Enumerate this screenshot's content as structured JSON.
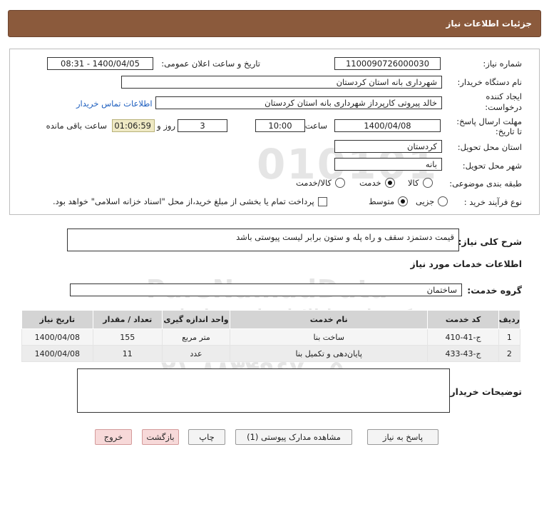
{
  "header": {
    "title": "جزئیات اطلاعات نیاز"
  },
  "form": {
    "need_number_label": "شماره نیاز:",
    "need_number": "1100090726000030",
    "announce_label": "تاریخ و ساعت اعلان عمومی:",
    "announce_value": "1400/04/05 - 08:31",
    "buyer_org_label": "نام دستگاه خریدار:",
    "buyer_org": "شهرداری بانه استان کردستان",
    "creator_label_1": "ایجاد کننده",
    "creator_label_2": "درخواست:",
    "creator": "خالد پیروتی کارپرداز شهرداری بانه استان کردستان",
    "contact_link": "اطلاعات تماس خریدار",
    "deadline_label_1": "مهلت ارسال پاسخ:",
    "deadline_label_2": "تا تاریخ:",
    "deadline_date": "1400/04/08",
    "time_label": "ساعت",
    "deadline_time": "10:00",
    "days_value": "3",
    "days_label": "روز و",
    "remaining_time": "01:06:59",
    "remaining_label": "ساعت باقی مانده",
    "province_label": "استان محل تحویل:",
    "province": "کردستان",
    "city_label": "شهر محل تحویل:",
    "city": "بانه",
    "category_label": "طبقه بندی موضوعی:",
    "category_options": [
      "کالا",
      "خدمت",
      "کالا/خدمت"
    ],
    "category_selected": "خدمت",
    "process_label": "نوع فرآیند خرید :",
    "process_options": [
      "جزیی",
      "متوسط"
    ],
    "process_selected": "متوسط",
    "payment_note": "پرداخت تمام یا بخشی از مبلغ خرید،از محل \"اسناد خزانه اسلامی\" خواهد بود."
  },
  "description": {
    "label": "شرح کلی نیاز:",
    "text": "قیمت دستمزد سقف و راه پله و ستون برابر لیست پیوستی باشد"
  },
  "services": {
    "section_title": "اطلاعات خدمات مورد نیاز",
    "group_label": "گروه خدمت:",
    "group_value": "ساختمان",
    "columns": [
      "ردیف",
      "کد خدمت",
      "نام خدمت",
      "واحد اندازه گیری",
      "تعداد / مقدار",
      "تاریخ نیاز"
    ],
    "rows": [
      [
        "1",
        "ج-41-410",
        "ساخت بنا",
        "متر مربع",
        "155",
        "1400/04/08"
      ],
      [
        "2",
        "ج-43-433",
        "پایان‌دهی و تکمیل بنا",
        "عدد",
        "11",
        "1400/04/08"
      ]
    ]
  },
  "buyer_notes": {
    "label": "توضیحات خریدار:",
    "text": ""
  },
  "buttons": {
    "reply": "پاسخ به نیاز",
    "attachments": "مشاهده مدارک پیوستی (1)",
    "print": "چاپ",
    "back": "بازگشت",
    "exit": "خروج"
  },
  "watermark": {
    "digits": "010101",
    "brand": "ParsNamadData",
    "line1": "مرکز فراوری اطلاعات پارس نماد داده",
    "line2": "پایگاه اطلاع رسانی مناقصه ومزایده",
    "phone": "۰۲۱-۸۸۳۴۹۶۷۰-۵"
  }
}
